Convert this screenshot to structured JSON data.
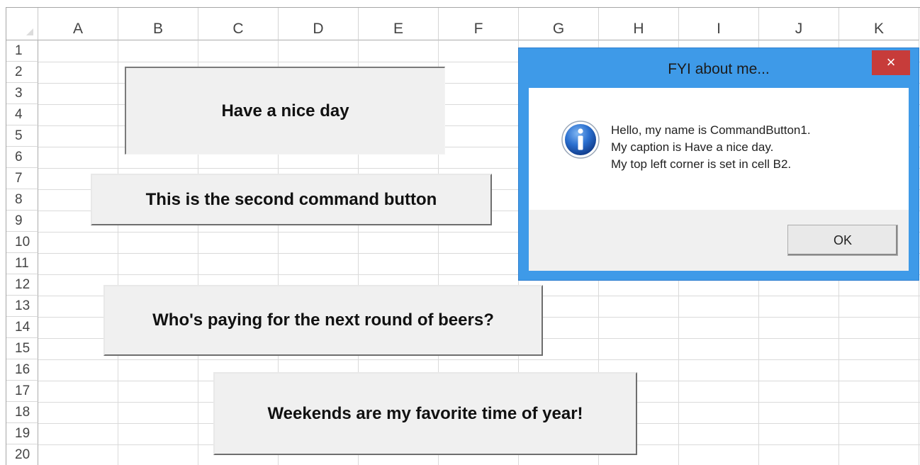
{
  "spreadsheet": {
    "columns": [
      "A",
      "B",
      "C",
      "D",
      "E",
      "F",
      "G",
      "H",
      "I",
      "J",
      "K"
    ],
    "rows": [
      "1",
      "2",
      "3",
      "4",
      "5",
      "6",
      "7",
      "8",
      "9",
      "10",
      "11",
      "12",
      "13",
      "14",
      "15",
      "16",
      "17",
      "18",
      "19",
      "20"
    ]
  },
  "buttons": {
    "button1": "Have a nice day",
    "button2": "This is the second command button",
    "button3": "Who's paying for the next round of beers?",
    "button4": "Weekends are my favorite time of year!"
  },
  "dialog": {
    "title": "FYI about me...",
    "close_symbol": "×",
    "icon": "information-icon",
    "message_lines": [
      "Hello, my name is CommandButton1.",
      "My caption is Have a nice day.",
      "My top left corner is set in cell B2."
    ],
    "ok_label": "OK"
  },
  "colors": {
    "dialog_frame": "#3e9ae8",
    "close_button": "#c73c3a",
    "info_icon": "#1e5fbf"
  }
}
